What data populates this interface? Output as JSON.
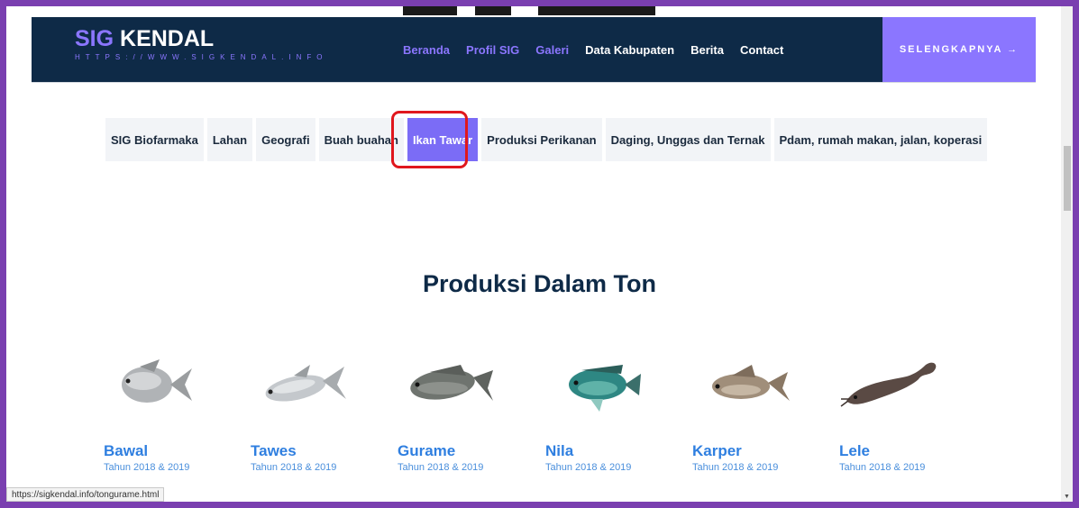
{
  "brand": {
    "name_accent": "SIG",
    "name_rest": " KENDAL",
    "url": "HTTPS://WWW.SIGKENDAL.INFO"
  },
  "nav": {
    "links": [
      {
        "label": "Beranda",
        "active": true
      },
      {
        "label": "Profil SIG",
        "active": true
      },
      {
        "label": "Galeri",
        "active": true
      },
      {
        "label": "Data Kabupaten",
        "active": false
      },
      {
        "label": "Berita",
        "active": false
      },
      {
        "label": "Contact",
        "active": false
      }
    ],
    "cta_label": "SELENGKAPNYA →"
  },
  "filters": [
    {
      "label": "SIG Biofarmaka",
      "active": false
    },
    {
      "label": "Lahan",
      "active": false
    },
    {
      "label": "Geografi",
      "active": false
    },
    {
      "label": "Buah buahan",
      "active": false
    },
    {
      "label": "Ikan Tawar",
      "active": true
    },
    {
      "label": "Produksi Perikanan",
      "active": false
    },
    {
      "label": "Daging, Unggas dan Ternak",
      "active": false
    },
    {
      "label": "Pdam, rumah makan, jalan, koperasi",
      "active": false
    }
  ],
  "section": {
    "title": "Produksi Dalam Ton"
  },
  "fish": [
    {
      "name": "Bawal",
      "subtitle": "Tahun 2018 & 2019",
      "icon": "bawal-fish-icon",
      "color": "#a9a9a9"
    },
    {
      "name": "Tawes",
      "subtitle": "Tahun 2018 & 2019",
      "icon": "tawes-fish-icon",
      "color": "#b7bcc0"
    },
    {
      "name": "Gurame",
      "subtitle": "Tahun 2018 & 2019",
      "icon": "gurame-fish-icon",
      "color": "#6b6f6a"
    },
    {
      "name": "Nila",
      "subtitle": "Tahun 2018 & 2019",
      "icon": "nila-fish-icon",
      "color": "#2e8a86"
    },
    {
      "name": "Karper",
      "subtitle": "Tahun 2018 & 2019",
      "icon": "karper-fish-icon",
      "color": "#9a8a78"
    },
    {
      "name": "Lele",
      "subtitle": "Tahun 2018 & 2019",
      "icon": "lele-fish-icon",
      "color": "#5a4a44"
    }
  ],
  "status_bar": {
    "url": "https://sigkendal.info/tongurame.html"
  },
  "colors": {
    "accent": "#8b76ff",
    "nav_bg": "#0e2a47",
    "link_blue": "#2f7fe0",
    "highlight": "#e0171d"
  }
}
